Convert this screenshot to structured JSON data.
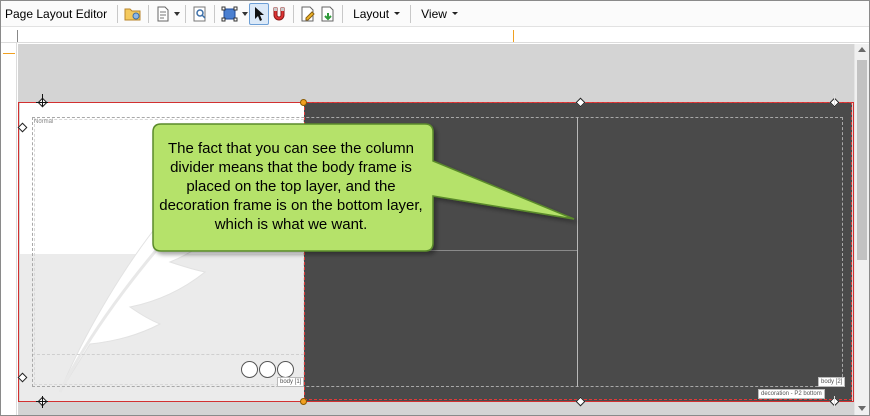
{
  "toolbar": {
    "title": "Page Layout Editor",
    "menus": {
      "layout": "Layout",
      "view": "View"
    },
    "icons": [
      "open-folder-icon",
      "page-properties-icon",
      "zoom-icon",
      "frame-select-icon",
      "pointer-icon",
      "magnet-icon",
      "edit-page-icon",
      "save-page-icon"
    ]
  },
  "canvas": {
    "style_label": "Normal",
    "body_label": "body [1]",
    "body_label_2": "body [2]",
    "decoration_label": "decoration - P2 bottom"
  },
  "callout": {
    "text": "The fact that you can see the column divider means that the body frame is placed on the top layer, and the decoration frame is on the bottom layer, which is what we want.",
    "fill": "#b5e26a",
    "border": "#5a8a2a"
  },
  "colors": {
    "page_outline": "#d23030",
    "dark_panel": "#4a4a4a",
    "accent": "#f0a020"
  }
}
